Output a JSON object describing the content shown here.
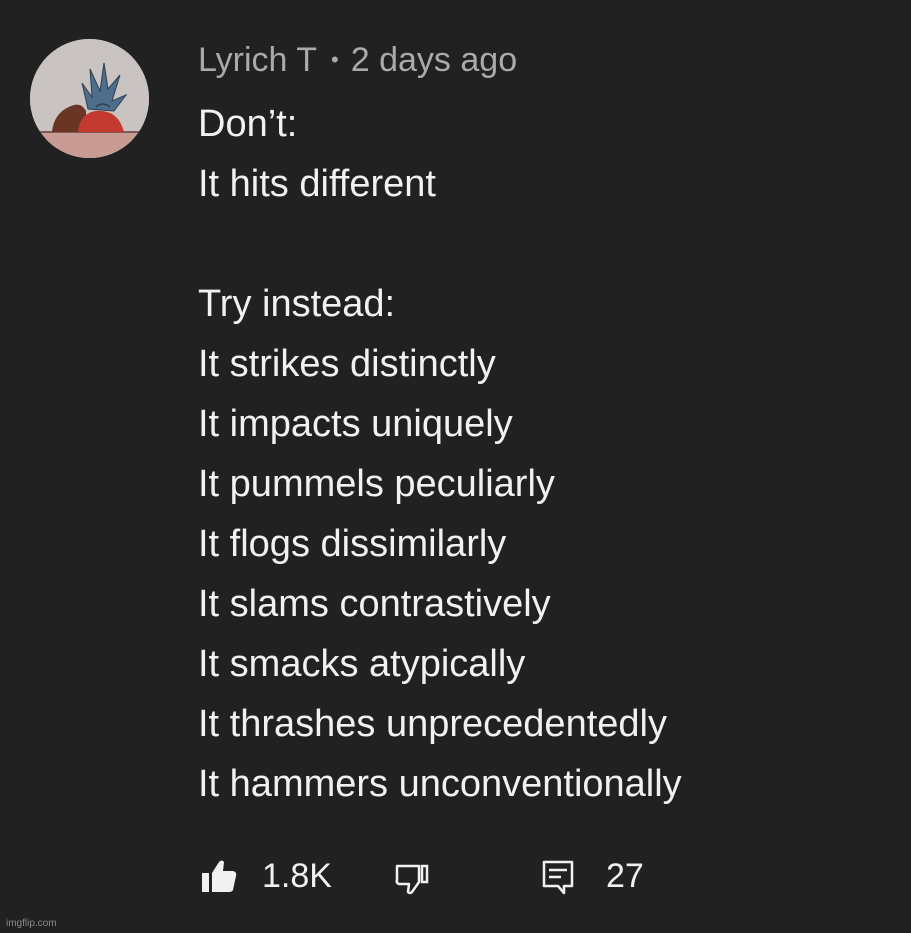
{
  "comment": {
    "author": "Lyrich T",
    "separator": "•",
    "timestamp": "2 days ago",
    "lines_top": [
      "Don’t:",
      "It hits different"
    ],
    "lines_bottom": [
      "Try instead:",
      "It strikes distinctly",
      "It impacts uniquely",
      "It pummels peculiarly",
      "It flogs dissimilarly",
      "It slams contrastively",
      "It smacks atypically",
      "It thrashes unprecedentedly",
      "It hammers unconventionally"
    ],
    "actions": {
      "like_count": "1.8K",
      "reply_count": "27"
    }
  },
  "watermark": "imgflip.com",
  "colors": {
    "background": "#212121",
    "text": "#f1f1f1",
    "meta": "#aaaaaa"
  }
}
